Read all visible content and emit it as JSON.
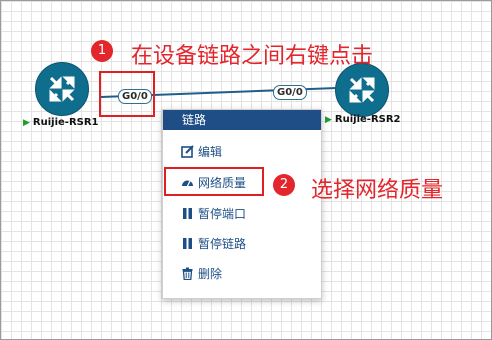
{
  "devices": {
    "left": {
      "label": "Ruijie-RSR1"
    },
    "right": {
      "label": "Ruijie-RSR2"
    }
  },
  "ports": {
    "left": "G0/0",
    "right": "G0/0"
  },
  "menu": {
    "header": "链路",
    "items": [
      "编辑",
      "网络质量",
      "暂停端口",
      "暂停链路",
      "删除"
    ]
  },
  "annotations": {
    "step1": {
      "number": "1",
      "text": "在设备链路之间右键点击"
    },
    "step2": {
      "number": "2",
      "text": "选择网络质量"
    }
  },
  "colors": {
    "accent_red": "#e3252c",
    "menu_header": "#1f4e86",
    "router_fill": "#0f6e8d",
    "link_line": "#1f5e8a"
  },
  "icons": {
    "router": "router-arrows-icon",
    "edit": "edit-icon",
    "quality": "gauge-icon",
    "pause": "pause-icon",
    "delete": "trash-icon"
  }
}
